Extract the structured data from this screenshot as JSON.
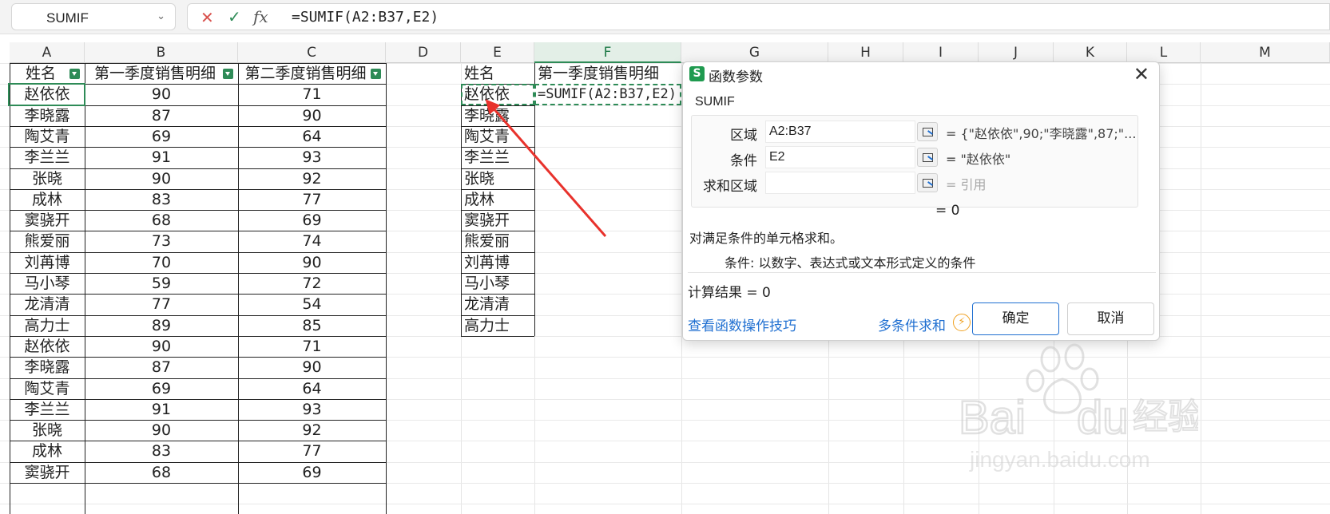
{
  "formula_bar": {
    "name_box": "SUMIF",
    "cancel_icon": "close-icon",
    "confirm_icon": "check-icon",
    "fx_label": "fx",
    "formula": "=SUMIF(A2:B37,E2)"
  },
  "columns": [
    "A",
    "B",
    "C",
    "D",
    "E",
    "F",
    "G",
    "H",
    "I",
    "J",
    "K",
    "L",
    "M"
  ],
  "active_column": "F",
  "table_left": {
    "headers": [
      "姓名",
      "第一季度销售明细",
      "第二季度销售明细"
    ],
    "rows": [
      [
        "赵依依",
        "90",
        "71"
      ],
      [
        "李晓露",
        "87",
        "90"
      ],
      [
        "陶艾青",
        "69",
        "64"
      ],
      [
        "李兰兰",
        "91",
        "93"
      ],
      [
        "张晓",
        "90",
        "92"
      ],
      [
        "成林",
        "83",
        "77"
      ],
      [
        "窦骁开",
        "68",
        "69"
      ],
      [
        "熊爱丽",
        "73",
        "74"
      ],
      [
        "刘苒博",
        "70",
        "90"
      ],
      [
        "马小琴",
        "59",
        "72"
      ],
      [
        "龙清清",
        "77",
        "54"
      ],
      [
        "高力士",
        "89",
        "85"
      ],
      [
        "赵依依",
        "90",
        "71"
      ],
      [
        "李晓露",
        "87",
        "90"
      ],
      [
        "陶艾青",
        "69",
        "64"
      ],
      [
        "李兰兰",
        "91",
        "93"
      ],
      [
        "张晓",
        "90",
        "92"
      ],
      [
        "成林",
        "83",
        "77"
      ],
      [
        "窦骁开",
        "68",
        "69"
      ]
    ]
  },
  "table_right": {
    "header_name": "姓名",
    "header_detail": "第一季度销售明细",
    "names": [
      "赵依依",
      "李晓露",
      "陶艾青",
      "李兰兰",
      "张晓",
      "成林",
      "窦骁开",
      "熊爱丽",
      "刘苒博",
      "马小琴",
      "龙清清",
      "高力士"
    ],
    "editing_formula": "=SUMIF(A2:B37,E2)"
  },
  "dialog": {
    "title": "函数参数",
    "logo": "S",
    "function_name": "SUMIF",
    "args": [
      {
        "label": "区域",
        "value": "A2:B37",
        "preview": "= {\"赵依依\",90;\"李晓露\",87;\"..."
      },
      {
        "label": "条件",
        "value": "E2",
        "preview": "= \"赵依依\""
      },
      {
        "label": "求和区域",
        "value": "",
        "preview": "= 引用"
      }
    ],
    "result_eq": "= 0",
    "description": "对满足条件的单元格求和。",
    "param_desc": "条件:  以数字、表达式或文本形式定义的条件",
    "calc_result": "计算结果 = 0",
    "link_tips": "查看函数操作技巧",
    "link_multi": "多条件求和",
    "ok": "确定",
    "cancel": "取消"
  },
  "watermark": {
    "brand": "Baidu",
    "suffix": "经验",
    "url": "jingyan.baidu.com"
  },
  "colors": {
    "accent": "#2e8b57",
    "link": "#1f6fd1",
    "arrow": "#e8322c"
  }
}
